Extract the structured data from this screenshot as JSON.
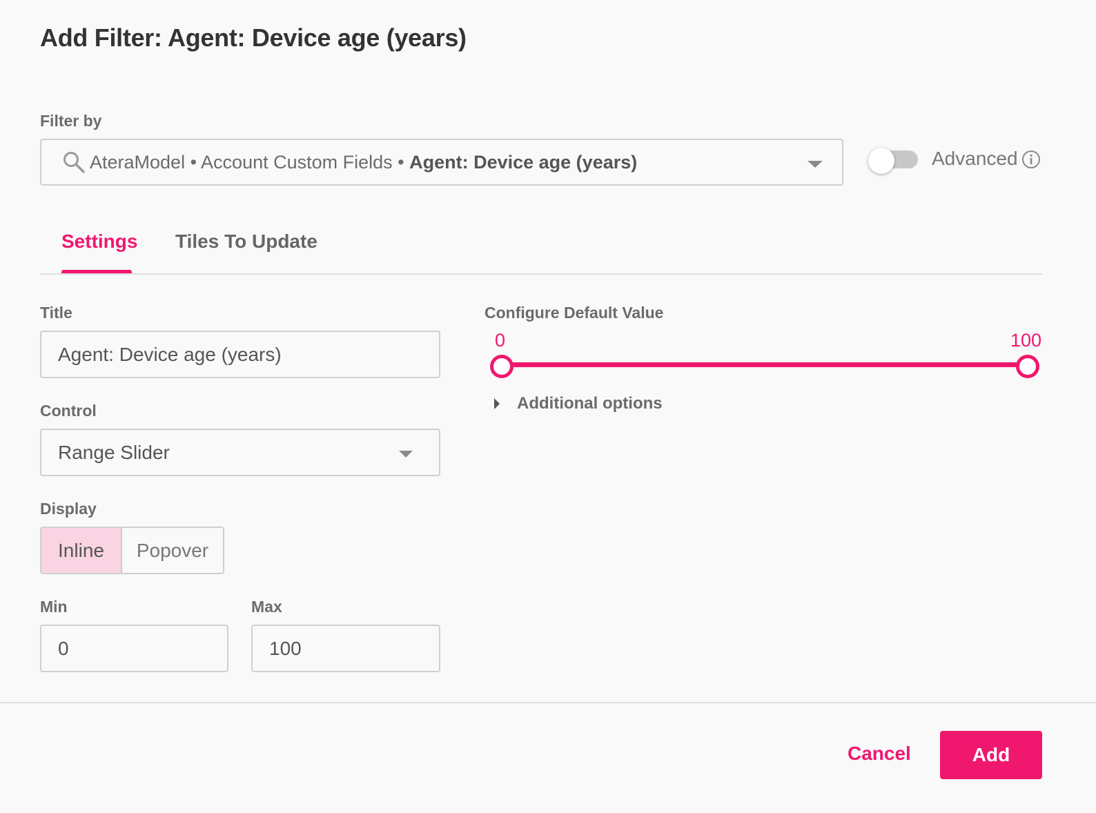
{
  "dialog": {
    "title": "Add Filter: Agent: Device age (years)"
  },
  "filter_by": {
    "label": "Filter by",
    "path_prefix": "AteraModel • Account Custom Fields • ",
    "path_field": "Agent: Device age (years)",
    "search_icon": "search-icon",
    "dropdown_icon": "chevron-down-icon"
  },
  "advanced": {
    "label": "Advanced",
    "enabled": false,
    "info_icon": "info-icon"
  },
  "tabs": [
    {
      "label": "Settings",
      "active": true
    },
    {
      "label": "Tiles To Update",
      "active": false
    }
  ],
  "settings": {
    "title_label": "Title",
    "title_value": "Agent: Device age (years)",
    "control_label": "Control",
    "control_value": "Range Slider",
    "display_label": "Display",
    "display_options": [
      "Inline",
      "Popover"
    ],
    "display_selected": "Inline",
    "min_label": "Min",
    "min_value": "0",
    "max_label": "Max",
    "max_value": "100"
  },
  "default_value": {
    "label": "Configure Default Value",
    "range_min_label": "0",
    "range_max_label": "100",
    "additional_options_label": "Additional options"
  },
  "footer": {
    "cancel_label": "Cancel",
    "add_label": "Add"
  },
  "colors": {
    "accent": "#f0186e",
    "selected_segment_bg": "#fad4e2"
  }
}
